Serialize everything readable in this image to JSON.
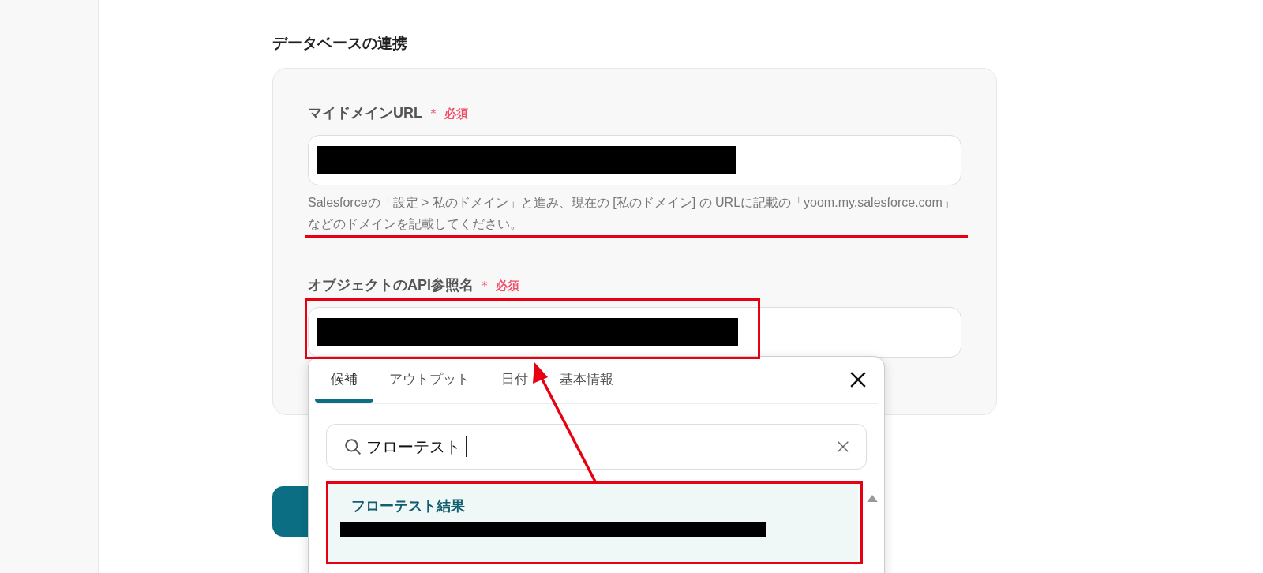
{
  "section_title": "データベースの連携",
  "fields": [
    {
      "label": "マイドメインURL",
      "required_mark": "＊",
      "required_text": "必須",
      "help": "Salesforceの「設定 > 私のドメイン」と進み、現在の [私のドメイン] の URLに記載の「yoom.my.salesforce.com」などのドメインを記載してください。"
    },
    {
      "label": "オブジェクトのAPI参照名",
      "required_mark": "＊",
      "required_text": "必須"
    }
  ],
  "popup": {
    "tabs": [
      {
        "label": "候補",
        "selected": true
      },
      {
        "label": "アウトプット",
        "selected": false
      },
      {
        "label": "日付",
        "selected": false
      },
      {
        "label": "基本情報",
        "selected": false
      }
    ],
    "search": {
      "value": "フローテスト"
    },
    "items": [
      {
        "title": "フローテスト結果",
        "selected": true
      }
    ]
  }
}
